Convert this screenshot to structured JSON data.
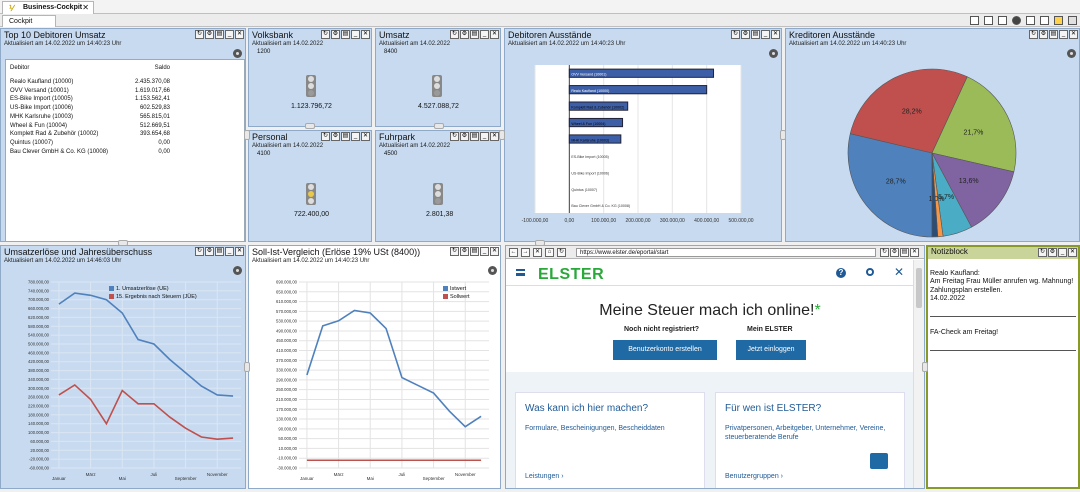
{
  "app": {
    "doc_tab": "Business-Cockpit",
    "sub_tab": "Cockpit"
  },
  "top10": {
    "title": "Top 10 Debitoren Umsatz",
    "subtitle": "Aktualisiert am 14.02.2022 um 14:40:23 Uhr",
    "col_debitor": "Debitor",
    "col_saldo": "Saldo",
    "rows": [
      {
        "name": "Realo Kaufland (10000)",
        "saldo": "2.435.370,08"
      },
      {
        "name": "OVV Versand (10001)",
        "saldo": "1.619.017,66"
      },
      {
        "name": "ES-Bike Import (10005)",
        "saldo": "1.153.562,41"
      },
      {
        "name": "US-Bike Import (10006)",
        "saldo": "602.529,83"
      },
      {
        "name": "MHK Karlsruhe (10003)",
        "saldo": "565.815,01"
      },
      {
        "name": "Wheel & Fun (10004)",
        "saldo": "512.669,51"
      },
      {
        "name": "Komplett Rad & Zubehör (10002)",
        "saldo": "393.654,68"
      },
      {
        "name": "Quintus (10007)",
        "saldo": "0,00"
      },
      {
        "name": "Bau Clever GmbH & Co. KG (10008)",
        "saldo": "0,00"
      }
    ]
  },
  "volksbank": {
    "title": "Volksbank",
    "subtitle": "Aktualisiert am 14.02.2022",
    "code": "1200",
    "value": "1.123.796,72",
    "light": "#9a9a9a"
  },
  "umsatz": {
    "title": "Umsatz",
    "subtitle": "Aktualisiert am 14.02.2022",
    "code": "8400",
    "value": "4.527.088,72",
    "light": "#9a9a9a"
  },
  "personal": {
    "title": "Personal",
    "subtitle": "Aktualisiert am 14.02.2022",
    "code": "4100",
    "value": "722.400,00",
    "light": "#e8c84a"
  },
  "fuhrpark": {
    "title": "Fuhrpark",
    "subtitle": "Aktualisiert am 14.02.2022",
    "code": "4500",
    "value": "2.801,38",
    "light": "#9a9a9a"
  },
  "debitoren": {
    "title": "Debitoren Ausstände",
    "subtitle": "Aktualisiert am 14.02.2022 um 14:40:23 Uhr"
  },
  "kreditoren": {
    "title": "Kreditoren Ausstände",
    "subtitle": "Aktualisiert am 14.02.2022 um 14:40:23 Uhr"
  },
  "umsatzerloese": {
    "title": "Umsatzerlöse und Jahresüberschuss",
    "subtitle": "Aktualisiert am 14.02.2022 um 14:46:03 Uhr"
  },
  "sollist": {
    "title": "Soll-Ist-Vergleich (Erlöse 19% USt (8400))",
    "subtitle": "Aktualisiert am 14.02.2022 um 14:40:23 Uhr"
  },
  "browser": {
    "url": "https://www.elster.de/eportal/start",
    "logo": "ELSTER",
    "headline": "Meine Steuer mach ich online!",
    "star": "*",
    "not_registered": "Noch nicht registriert?",
    "my_elster": "Mein ELSTER",
    "btn_create": "Benutzerkonto erstellen",
    "btn_login": "Jetzt einloggen",
    "card1_title": "Was kann ich hier machen?",
    "card1_text": "Formulare, Bescheinigungen, Bescheiddaten",
    "card1_link": "Leistungen ›",
    "card2_title": "Für wen ist ELSTER?",
    "card2_text": "Privatpersonen, Arbeitgeber, Unternehmer, Vereine, steuerberatende Berufe",
    "card2_link": "Benutzergruppen ›"
  },
  "notes": {
    "title": "Notizblock",
    "body": "Realo Kaufland:\nAm Freitag Frau Müller anrufen wg. Mahnung! Zahlungsplan erstellen.\n14.02.2022",
    "body2": "FA-Check am Freitag!"
  },
  "chart_data": [
    {
      "type": "bar",
      "title": "Debitoren Ausstände",
      "orientation": "horizontal",
      "categories": [
        "OVV Versand (10001)",
        "Realo Kaufland (10000)",
        "Komplett Rad & Zubehör (10002)",
        "Wheel & Fun (10004)",
        "MHK Karlsruhe (10003)",
        "ES-Bike Import (10005)",
        "US-Bike Import (10006)",
        "Quintus (10007)",
        "Bau Clever GmbH & Co. KG (10008)"
      ],
      "values": [
        420000,
        400000,
        170000,
        155000,
        150000,
        0,
        0,
        0,
        0
      ],
      "xlim": [
        -100000,
        500000
      ],
      "xticks": [
        "-100.000,00",
        "0,00",
        "100.000,00",
        "200.000,00",
        "300.000,00",
        "400.000,00",
        "500.000,00"
      ],
      "color": "#3d5fa8"
    },
    {
      "type": "pie",
      "title": "Kreditoren Ausstände",
      "slices": [
        {
          "label": "28,7%",
          "value": 28.7,
          "color": "#4f81bd"
        },
        {
          "label": "28,2%",
          "value": 28.2,
          "color": "#c0504d"
        },
        {
          "label": "21,7%",
          "value": 21.7,
          "color": "#9bbb59"
        },
        {
          "label": "13,6%",
          "value": 13.6,
          "color": "#8064a2"
        },
        {
          "label": "5,7%",
          "value": 5.7,
          "color": "#4bacc6"
        },
        {
          "label": "1,0%",
          "value": 1.0,
          "color": "#f79646"
        },
        {
          "label": "",
          "value": 1.1,
          "color": "#2c4d75"
        }
      ]
    },
    {
      "type": "line",
      "title": "Umsatzerlöse und Jahresüberschuss",
      "x": [
        "Januar",
        "Februar",
        "März",
        "April",
        "Mai",
        "Juni",
        "Juli",
        "August",
        "September",
        "Oktober",
        "November",
        "Dezember"
      ],
      "xticks": [
        "Januar",
        "März",
        "Mai",
        "Juli",
        "September",
        "November"
      ],
      "ylim": [
        -60000,
        780000
      ],
      "yticks": [
        "-60.000,00",
        "-20.000,00",
        "20.000,00",
        "60.000,00",
        "100.000,00",
        "140.000,00",
        "180.000,00",
        "220.000,00",
        "260.000,00",
        "300.000,00",
        "340.000,00",
        "380.000,00",
        "420.000,00",
        "460.000,00",
        "500.000,00",
        "540.000,00",
        "580.000,00",
        "620.000,00",
        "660.000,00",
        "700.000,00",
        "740.000,00",
        "780.000,00"
      ],
      "series": [
        {
          "name": "1. Umsatzerlöse (UE)",
          "color": "#4f81bd",
          "values": [
            680000,
            730000,
            720000,
            700000,
            640000,
            520000,
            500000,
            430000,
            370000,
            310000,
            270000,
            265000
          ]
        },
        {
          "name": "15. Ergebnis nach Steuern (JÜE)",
          "color": "#c0504d",
          "values": [
            270000,
            315000,
            250000,
            140000,
            290000,
            230000,
            230000,
            170000,
            120000,
            80000,
            70000,
            75000
          ]
        }
      ]
    },
    {
      "type": "line",
      "title": "Soll-Ist-Vergleich (Erlöse 19% USt (8400))",
      "x": [
        "Januar",
        "Februar",
        "März",
        "April",
        "Mai",
        "Juni",
        "Juli",
        "August",
        "September",
        "Oktober",
        "November",
        "Dezember"
      ],
      "xticks": [
        "Januar",
        "März",
        "Mai",
        "Juli",
        "September",
        "November"
      ],
      "ylim": [
        -30000,
        690000
      ],
      "yticks": [
        "-30.000,00",
        "-10.000,00",
        "10.000,00",
        "50.000,00",
        "90.000,00",
        "130.000,00",
        "170.000,00",
        "210.000,00",
        "250.000,00",
        "290.000,00",
        "330.000,00",
        "370.000,00",
        "410.000,00",
        "450.000,00",
        "490.000,00",
        "530.000,00",
        "570.000,00",
        "610.000,00",
        "650.000,00",
        "690.000,00"
      ],
      "series": [
        {
          "name": "Istwert",
          "color": "#4f81bd",
          "values": [
            330000,
            520000,
            540000,
            580000,
            570000,
            510000,
            320000,
            290000,
            260000,
            190000,
            130000,
            170000
          ]
        },
        {
          "name": "Sollwert",
          "color": "#c0504d",
          "values": [
            0,
            0,
            0,
            0,
            0,
            0,
            0,
            0,
            0,
            0,
            0,
            0
          ]
        }
      ]
    }
  ]
}
